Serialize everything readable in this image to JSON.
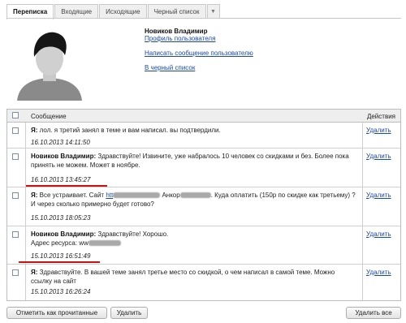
{
  "tabs": [
    {
      "label": "Переписка",
      "active": true
    },
    {
      "label": "Входящие",
      "active": false
    },
    {
      "label": "Исходящие",
      "active": false
    },
    {
      "label": "Черный список",
      "active": false
    }
  ],
  "tabs_more_icon": "chevron-down-icon",
  "profile": {
    "name": "Новиков Владимир",
    "profile_link": "Профиль пользователя",
    "write_link": "Написать сообщение пользователю",
    "blacklist_link": "В черный список"
  },
  "table": {
    "col_message": "Сообщение",
    "col_actions": "Действия",
    "rows": [
      {
        "sender": "Я:",
        "text": "лол. я третий занял в теме и вам написал. вы подтвердили.",
        "date": "16.10.2013 14:11:50",
        "delete": "Удалить"
      },
      {
        "sender": "Новиков Владимир:",
        "text": "Здравствуйте! Извините, уже набралось 10 человек со скидками и без. Более пока принять не можем. Может в ноябре.",
        "date": "16.10.2013 13:45:27",
        "delete": "Удалить"
      },
      {
        "sender": "Я:",
        "text_a": "Все устраивает. Сайт",
        "link_stub": "htt",
        "text_b": "Анкор",
        "text_c": ". Куда оплатить (150р по скидке как третьему) ? И через сколько примерно будет готово?",
        "date": "15.10.2013 18:05:23",
        "delete": "Удалить"
      },
      {
        "sender": "Новиков Владимир:",
        "text": "Здравствуйте! Хорошо.",
        "text_line2": "Адрес ресурса: ww",
        "date": "15.10.2013 16:51:49",
        "delete": "Удалить"
      },
      {
        "sender": "Я:",
        "text": "Здравствуйте. В вашей теме занял третье место со скидкой, о чем написал в самой теме. Можно ссылку на сайт",
        "date": "15.10.2013 16:26:24",
        "delete": "Удалить"
      }
    ]
  },
  "buttons": {
    "mark_read": "Отметить как прочитанные",
    "delete": "Удалить",
    "delete_all": "Удалить все"
  },
  "colors": {
    "link": "#1c49a8",
    "underline_mark": "#cc1111"
  }
}
